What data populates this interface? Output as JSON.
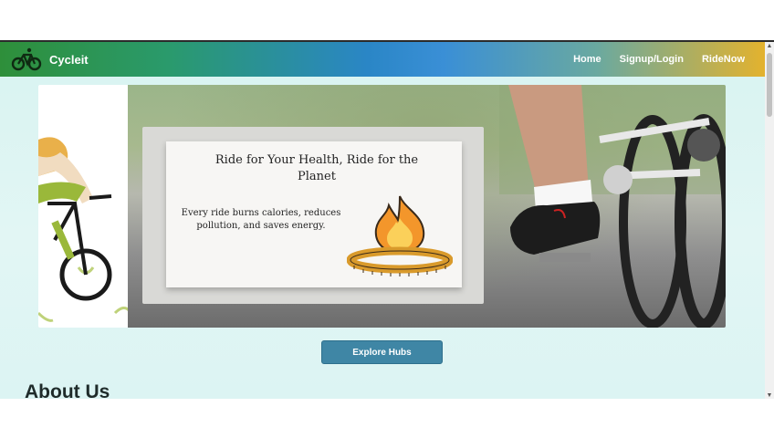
{
  "navbar": {
    "brand": "Cycleit",
    "links": [
      "Home",
      "Signup/Login",
      "RideNow"
    ],
    "gradient_colors": [
      "#2e8f3a",
      "#2a86c6",
      "#e3b22e"
    ]
  },
  "hero": {
    "card_title": "Ride for Your Health, Ride for the Planet",
    "card_text": "Every ride burns calories, reduces pollution, and saves energy.",
    "icons": [
      "flame-icon",
      "measuring-tape-icon"
    ]
  },
  "cta": {
    "label": "Explore Hubs",
    "color": "#3f86a5"
  },
  "about": {
    "heading": "About Us"
  },
  "icons": {
    "brand": "bicycle-icon",
    "scroll_up": "▲",
    "scroll_down": "▼"
  }
}
